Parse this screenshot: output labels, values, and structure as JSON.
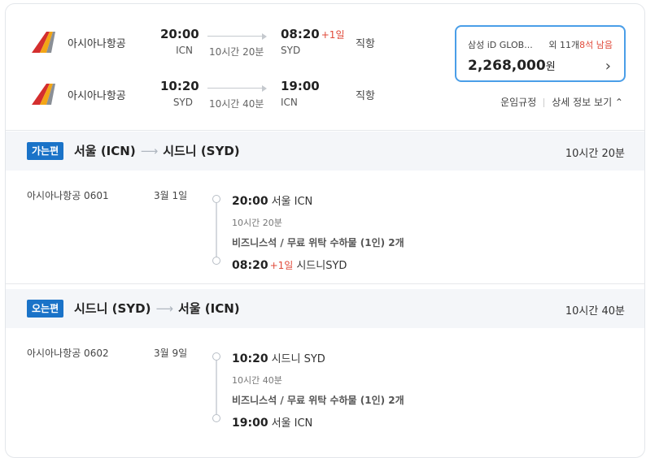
{
  "summary": {
    "outbound": {
      "airline": "아시아나항공",
      "dep_time": "20:00",
      "dep_code": "ICN",
      "duration": "10시간 20분",
      "arr_time": "08:20",
      "arr_plus": "+1일",
      "arr_code": "SYD",
      "stops": "직항"
    },
    "inbound": {
      "airline": "아시아나항공",
      "dep_time": "10:20",
      "dep_code": "SYD",
      "duration": "10시간 40분",
      "arr_time": "19:00",
      "arr_code": "ICN",
      "stops": "직항"
    }
  },
  "price_box": {
    "vendor": "삼성 iD GLOB...",
    "others_prefix": "외 11개",
    "seats_left": "8석 남음",
    "price": "2,268,000",
    "currency": "원"
  },
  "links": {
    "fare_rules": "운임규정",
    "details_toggle": "상세 정보 보기 ⌃"
  },
  "segments": [
    {
      "badge": "가는편",
      "from": "서울 (ICN)",
      "arrow": "⟶",
      "to": "시드니 (SYD)",
      "total_duration": "10시간 20분",
      "flight_no": "아시아나항공 0601",
      "date": "3월 1일",
      "dep_time": "20:00",
      "dep_place": "서울 ICN",
      "duration": "10시간 20분",
      "cabin": "비즈니스석 / 무료 위탁 수하물 (1인) 2개",
      "arr_time": "08:20",
      "arr_plus": "+1일",
      "arr_place": "시드니SYD"
    },
    {
      "badge": "오는편",
      "from": "시드니 (SYD)",
      "arrow": "⟶",
      "to": "서울 (ICN)",
      "total_duration": "10시간 40분",
      "flight_no": "아시아나항공 0602",
      "date": "3월 9일",
      "dep_time": "10:20",
      "dep_place": "시드니 SYD",
      "duration": "10시간 40분",
      "cabin": "비즈니스석 / 무료 위탁 수하물 (1인) 2개",
      "arr_time": "19:00",
      "arr_place": "서울 ICN"
    }
  ],
  "colors": {
    "accent": "#1a73c8",
    "price_border": "#4a9ee8",
    "warn": "#e04a3a"
  }
}
